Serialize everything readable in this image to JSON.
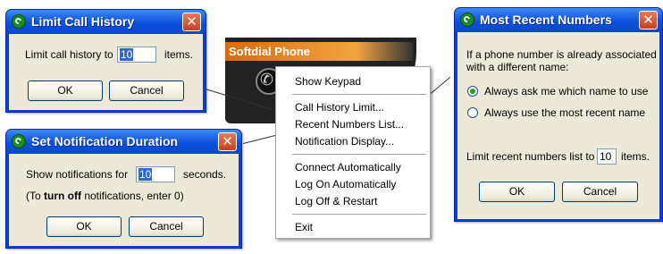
{
  "limit_call_history_dialog": {
    "title": "Limit Call History",
    "label": "Limit call history to",
    "value": "10",
    "suffix": "items.",
    "ok_label": "OK",
    "cancel_label": "Cancel"
  },
  "notification_dialog": {
    "title": "Set Notification Duration",
    "label": "Show notifications for",
    "value": "10",
    "suffix": "seconds.",
    "hint_prefix": "(To ",
    "hint_bold": "turn off",
    "hint_suffix": " notifications, enter 0)",
    "ok_label": "OK",
    "cancel_label": "Cancel"
  },
  "recent_numbers_dialog": {
    "title": "Most Recent Numbers",
    "description_line1": "If a phone number is already associated",
    "description_line2": "with a different name:",
    "option_ask": "Always ask me which name to use",
    "option_recent": "Always use the most recent name",
    "selected_option": "option_ask",
    "limit_label": "Limit recent numbers list to",
    "limit_value": "10",
    "limit_suffix": "items.",
    "ok_label": "OK",
    "cancel_label": "Cancel"
  },
  "phone": {
    "brand": "Softdial Phone"
  },
  "context_menu": {
    "items": [
      "Show Keypad",
      "Call History Limit...",
      "Recent Numbers List...",
      "Notification Display...",
      "Connect Automatically",
      "Log On Automatically",
      "Log Off & Restart",
      "Exit"
    ]
  },
  "colors": {
    "titlebar": "#0a4fd8",
    "dialog_bg": "#ece9d8",
    "close_button": "#c9401c",
    "phone_accent": "#f2a440"
  },
  "icons": {
    "title_icon": "softdial-phone-icon",
    "close": "close-icon",
    "phone_handset": "phone-handset-icon"
  }
}
